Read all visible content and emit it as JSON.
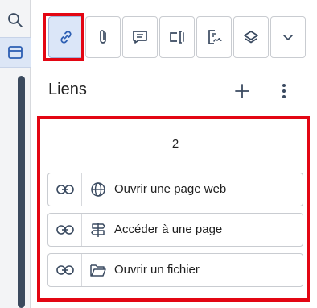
{
  "rail": {
    "search_icon": "search-icon",
    "panel_icon": "panel-icon"
  },
  "toolbar": {
    "buttons": [
      {
        "icon": "link-icon",
        "active": true
      },
      {
        "icon": "paperclip-icon",
        "active": false
      },
      {
        "icon": "comment-icon",
        "active": false
      },
      {
        "icon": "text-field-icon",
        "active": false
      },
      {
        "icon": "signature-icon",
        "active": false
      },
      {
        "icon": "layers-icon",
        "active": false
      },
      {
        "icon": "chevron-down-icon",
        "active": false
      }
    ]
  },
  "panel": {
    "title": "Liens",
    "add_icon": "plus-icon",
    "more_icon": "more-vertical-icon"
  },
  "links": {
    "count": "2",
    "items": [
      {
        "label": "Ouvrir une page web",
        "type_icon": "globe-icon"
      },
      {
        "label": "Accéder à une page",
        "type_icon": "signpost-icon"
      },
      {
        "label": "Ouvrir un fichier",
        "type_icon": "folder-icon"
      }
    ]
  },
  "colors": {
    "highlight": "#e30613",
    "active_bg": "#dbe6f8",
    "icon": "#3a4a60",
    "border": "#c9ccd1"
  }
}
